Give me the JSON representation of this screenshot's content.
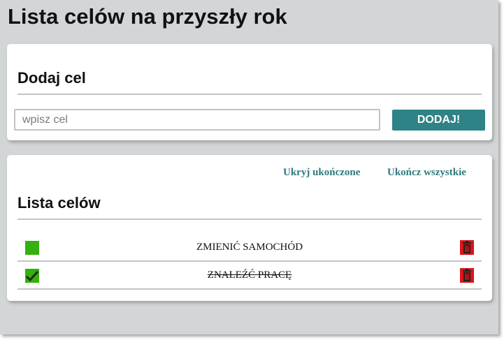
{
  "app": {
    "title": "Lista celów na przyszły rok"
  },
  "add_section": {
    "heading": "Dodaj cel",
    "input_placeholder": "wpisz cel",
    "input_value": "",
    "button_label": "DODAJ!"
  },
  "list_section": {
    "heading": "Lista celów",
    "hide_completed_label": "Ukryj ukończone",
    "complete_all_label": "Ukończ wszystkie",
    "items": [
      {
        "text": "ZMIENIĆ SAMOCHÓD",
        "completed": false
      },
      {
        "text": "ZNALEŹĆ PRACĘ",
        "completed": true
      }
    ]
  },
  "colors": {
    "background": "#d2d6d6",
    "accent": "#2f8285",
    "check_green": "#35b00f",
    "delete_red": "#d9151a"
  },
  "icons": {
    "check": "checkmark-icon",
    "delete": "trash-icon"
  }
}
